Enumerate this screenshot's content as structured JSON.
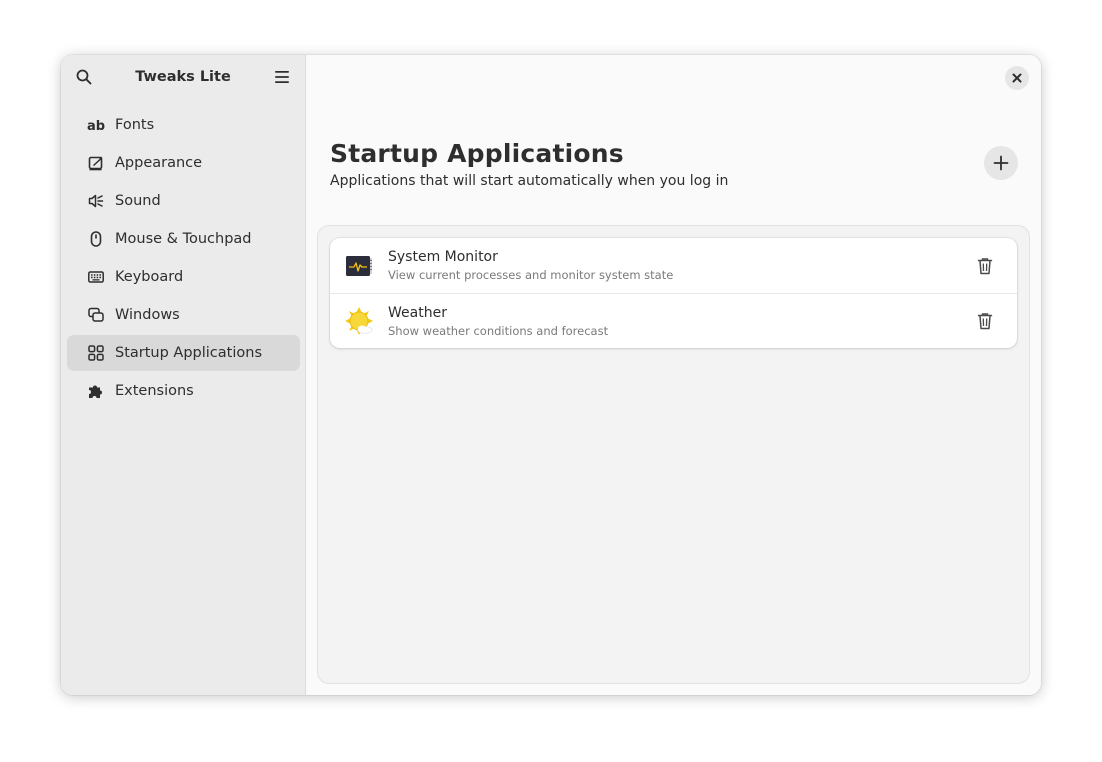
{
  "sidebar": {
    "title": "Tweaks Lite",
    "items": [
      {
        "label": "Fonts",
        "icon": "font-icon"
      },
      {
        "label": "Appearance",
        "icon": "appearance-icon"
      },
      {
        "label": "Sound",
        "icon": "sound-icon"
      },
      {
        "label": "Mouse & Touchpad",
        "icon": "mouse-icon"
      },
      {
        "label": "Keyboard",
        "icon": "keyboard-icon"
      },
      {
        "label": "Windows",
        "icon": "windows-icon"
      },
      {
        "label": "Startup Applications",
        "icon": "grid-icon",
        "active": true
      },
      {
        "label": "Extensions",
        "icon": "puzzle-icon"
      }
    ]
  },
  "main": {
    "title": "Startup Applications",
    "subtitle": "Applications that will start automatically when you log in",
    "apps": [
      {
        "name": "System Monitor",
        "description": "View current processes and monitor system state",
        "icon": "system-monitor-icon"
      },
      {
        "name": "Weather",
        "description": "Show weather conditions and forecast",
        "icon": "weather-icon"
      }
    ]
  },
  "colors": {
    "sidebar_bg": "#ebebeb",
    "active_item_bg": "#d9d9d9",
    "content_bg": "#fafafa",
    "card_bg": "#ffffff"
  }
}
